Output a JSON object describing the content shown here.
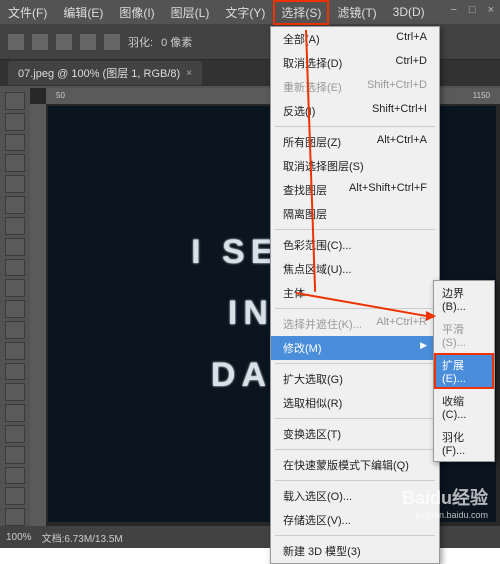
{
  "menubar": {
    "items": [
      "文件(F)",
      "编辑(E)",
      "图像(I)",
      "图层(L)",
      "文字(Y)",
      "选择(S)",
      "滤镜(T)",
      "3D(D)"
    ]
  },
  "window": {
    "min": "−",
    "max": "□",
    "close": "×"
  },
  "toolbar": {
    "feather_label": "羽化:",
    "feather_value": "0 像素"
  },
  "tab": {
    "title": "07.jpeg @ 100% (图层 1, RGB/8)",
    "close": "×"
  },
  "ruler": {
    "tick1": "50",
    "tick2": "1150"
  },
  "canvas": {
    "line1": "I SEE A",
    "line2": "IN T",
    "line3": "DARK"
  },
  "menu_select": {
    "all": {
      "label": "全部(A)",
      "shortcut": "Ctrl+A"
    },
    "deselect": {
      "label": "取消选择(D)",
      "shortcut": "Ctrl+D"
    },
    "reselect": {
      "label": "重新选择(E)",
      "shortcut": "Shift+Ctrl+D"
    },
    "inverse": {
      "label": "反选(I)",
      "shortcut": "Shift+Ctrl+I"
    },
    "alllayers": {
      "label": "所有图层(Z)",
      "shortcut": "Alt+Ctrl+A"
    },
    "deselectlayers": {
      "label": "取消选择图层(S)",
      "shortcut": ""
    },
    "findlayers": {
      "label": "查找图层",
      "shortcut": "Alt+Shift+Ctrl+F"
    },
    "isolate": {
      "label": "隔离图层",
      "shortcut": ""
    },
    "colorrange": {
      "label": "色彩范围(C)...",
      "shortcut": ""
    },
    "focusarea": {
      "label": "焦点区域(U)...",
      "shortcut": ""
    },
    "subject": {
      "label": "主体",
      "shortcut": ""
    },
    "selectmask": {
      "label": "选择并遮住(K)...",
      "shortcut": "Alt+Ctrl+R"
    },
    "modify": {
      "label": "修改(M)",
      "arrow": "▶"
    },
    "grow": {
      "label": "扩大选取(G)",
      "shortcut": ""
    },
    "similar": {
      "label": "选取相似(R)",
      "shortcut": ""
    },
    "transform": {
      "label": "变换选区(T)",
      "shortcut": ""
    },
    "quickmask": {
      "label": "在快速蒙版模式下编辑(Q)",
      "shortcut": ""
    },
    "load": {
      "label": "载入选区(O)...",
      "shortcut": ""
    },
    "save": {
      "label": "存储选区(V)...",
      "shortcut": ""
    },
    "new3d": {
      "label": "新建 3D 模型(3)",
      "shortcut": ""
    }
  },
  "submenu_modify": {
    "border": "边界(B)...",
    "smooth": "平滑(S)...",
    "expand": "扩展(E)...",
    "contract": "收缩(C)...",
    "feather": "羽化(F)..."
  },
  "status": {
    "zoom": "100%",
    "doc": "文档:6.73M/13.5M"
  },
  "watermark": {
    "brand": "Baidu经验",
    "url": "jingyan.baidu.com"
  }
}
